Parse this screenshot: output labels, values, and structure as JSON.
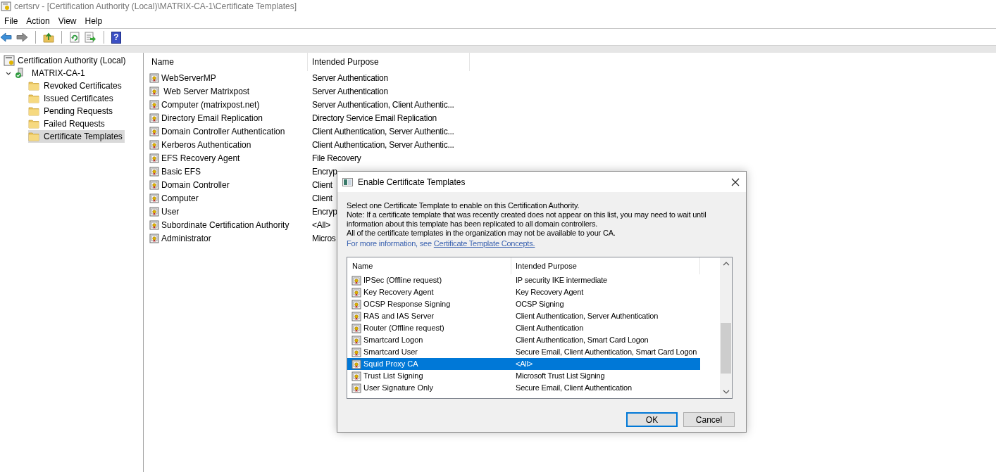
{
  "window": {
    "title": "certsrv - [Certification Authority (Local)\\MATRIX-CA-1\\Certificate Templates]"
  },
  "menu": [
    "File",
    "Action",
    "View",
    "Help"
  ],
  "toolbar": {
    "help_glyph": "?"
  },
  "tree": {
    "root": "Certification Authority (Local)",
    "items": [
      {
        "label": "MATRIX-CA-1",
        "expanded": true,
        "children": [
          {
            "label": "Revoked Certificates",
            "selected": false
          },
          {
            "label": "Issued Certificates",
            "selected": false
          },
          {
            "label": "Pending Requests",
            "selected": false
          },
          {
            "label": "Failed Requests",
            "selected": false
          },
          {
            "label": "Certificate Templates",
            "selected": true
          }
        ]
      }
    ]
  },
  "list": {
    "columns": [
      "Name",
      "Intended Purpose"
    ],
    "rows": [
      {
        "name": "WebServerMP",
        "purpose": "Server Authentication"
      },
      {
        "name": " Web Server Matrixpost",
        "purpose": "Server Authentication"
      },
      {
        "name": "Computer (matrixpost.net)",
        "purpose": "Server Authentication, Client Authentic..."
      },
      {
        "name": "Directory Email Replication",
        "purpose": "Directory Service Email Replication"
      },
      {
        "name": "Domain Controller Authentication",
        "purpose": "Client Authentication, Server Authentic..."
      },
      {
        "name": "Kerberos Authentication",
        "purpose": "Client Authentication, Server Authentic..."
      },
      {
        "name": "EFS Recovery Agent",
        "purpose": "File Recovery"
      },
      {
        "name": "Basic EFS",
        "purpose": "Encryp"
      },
      {
        "name": "Domain Controller",
        "purpose": "Client"
      },
      {
        "name": "Computer",
        "purpose": "Client"
      },
      {
        "name": "User",
        "purpose": "Encryp"
      },
      {
        "name": "Subordinate Certification Authority",
        "purpose": "<All>"
      },
      {
        "name": "Administrator",
        "purpose": "Micros"
      }
    ]
  },
  "dialog": {
    "title": "Enable Certificate Templates",
    "lines": [
      "Select one Certificate Template to enable on this Certification Authority.",
      "Note: If a certificate template that was recently created does not appear on this list, you may need to wait until information about this template has been replicated to all domain controllers.",
      "All of the certificate templates in the organization may not be available to your CA."
    ],
    "info_text": "For more information, see",
    "link": "Certificate Template Concepts.",
    "columns": [
      "Name",
      "Intended Purpose"
    ],
    "rows": [
      {
        "name": "IPSec (Offline request)",
        "purpose": "IP security IKE intermediate",
        "selected": false
      },
      {
        "name": "Key Recovery Agent",
        "purpose": "Key Recovery Agent",
        "selected": false
      },
      {
        "name": "OCSP Response Signing",
        "purpose": "OCSP Signing",
        "selected": false
      },
      {
        "name": "RAS and IAS Server",
        "purpose": "Client Authentication, Server Authentication",
        "selected": false
      },
      {
        "name": "Router (Offline request)",
        "purpose": "Client Authentication",
        "selected": false
      },
      {
        "name": "Smartcard Logon",
        "purpose": "Client Authentication, Smart Card Logon",
        "selected": false
      },
      {
        "name": "Smartcard User",
        "purpose": "Secure Email, Client Authentication, Smart Card Logon",
        "selected": false
      },
      {
        "name": "Squid Proxy CA",
        "purpose": "<All>",
        "selected": true
      },
      {
        "name": "Trust List Signing",
        "purpose": "Microsoft Trust List Signing",
        "selected": false
      },
      {
        "name": "User Signature Only",
        "purpose": "Secure Email, Client Authentication",
        "selected": false
      }
    ],
    "buttons": [
      {
        "label": "OK",
        "default": true
      },
      {
        "label": "Cancel",
        "default": false
      }
    ]
  }
}
